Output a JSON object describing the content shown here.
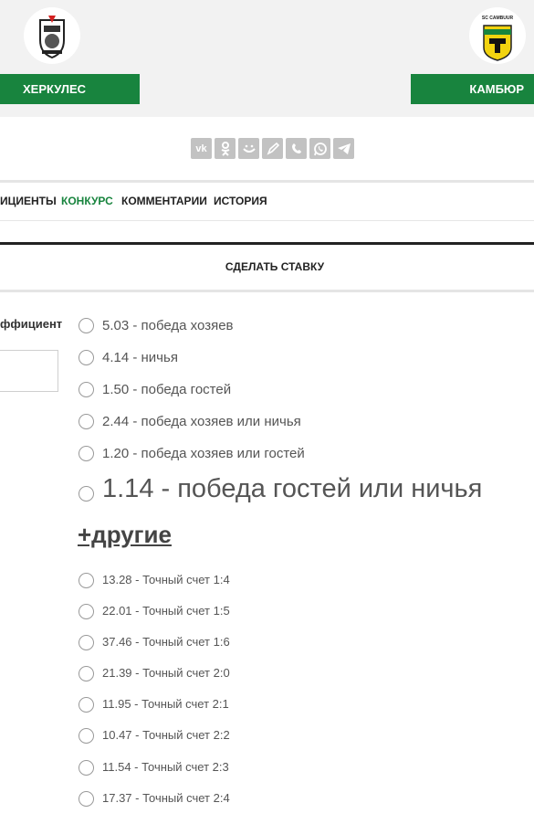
{
  "teams": {
    "home": "ХЕРКУЛЕС",
    "away": "КАМБЮР",
    "away_logo_text": "SC CAMBUUR"
  },
  "share": [
    "vk-icon",
    "ok-icon",
    "mail-icon",
    "livejournal-icon",
    "viber-icon",
    "whatsapp-icon",
    "telegram-icon"
  ],
  "tabs": [
    {
      "label": "ИЦИЕНТЫ"
    },
    {
      "label": "КОНКУРС"
    },
    {
      "label": "КОММЕНТАРИИ"
    },
    {
      "label": "ИСТОРИЯ"
    }
  ],
  "bet": {
    "title": "СДЕЛАТЬ СТАВКУ",
    "coef_label": "ффициент",
    "coef_value": ""
  },
  "main_options": [
    "5.03 - победа хозяев",
    "4.14 - ничья",
    "1.50 - победа гостей",
    "2.44 - победа хозяев или ничья",
    "1.20 - победа хозяев или гостей",
    "1.14 - победа гостей или ничья"
  ],
  "others_label": "+другие",
  "score_options": [
    "13.28 - Точный счет 1:4",
    "22.01 - Точный счет 1:5",
    "37.46 - Точный счет 1:6",
    "21.39 - Точный счет 2:0",
    "11.95 - Точный счет 2:1",
    "10.47 - Точный счет 2:2",
    "11.54 - Точный счет 2:3",
    "17.37 - Точный счет 2:4"
  ],
  "colors": {
    "accent": "#18843e",
    "header_bg": "#f2f2f2",
    "share_icon": "#c2c2c2"
  }
}
